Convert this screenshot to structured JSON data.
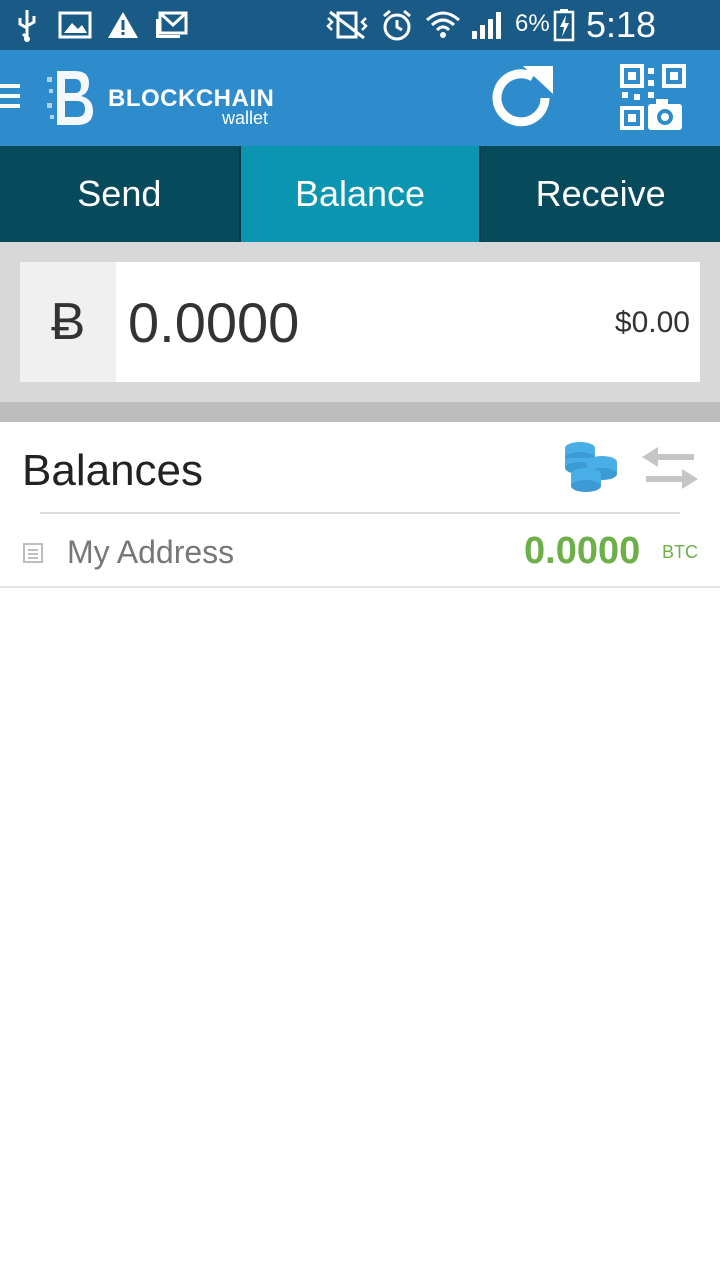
{
  "status_bar": {
    "icons": [
      "usb-icon",
      "image-icon",
      "warning-icon",
      "mail-icon",
      "vibrate-icon",
      "alarm-icon",
      "wifi-icon",
      "signal-icon",
      "battery-charging-icon"
    ],
    "battery_percent": "6%",
    "time": "5:18 PM"
  },
  "header": {
    "brand": "BLOCKCHAIN",
    "subtitle": "wallet",
    "color": "#2e8ccc"
  },
  "tabs": [
    {
      "label": "Send",
      "active": false
    },
    {
      "label": "Balance",
      "active": true
    },
    {
      "label": "Receive",
      "active": false
    }
  ],
  "balance": {
    "currency_symbol": "Ƀ",
    "amount": "0.0000",
    "fiat": "$0.00"
  },
  "balances_section": {
    "title": "Balances",
    "items": [
      {
        "label": "My Address",
        "amount": "0.0000",
        "unit": "BTC"
      }
    ]
  },
  "colors": {
    "status_bar": "#1a5a87",
    "tab_bg": "#064a5c",
    "tab_active": "#0a95b0",
    "positive_amount": "#6db04a"
  }
}
